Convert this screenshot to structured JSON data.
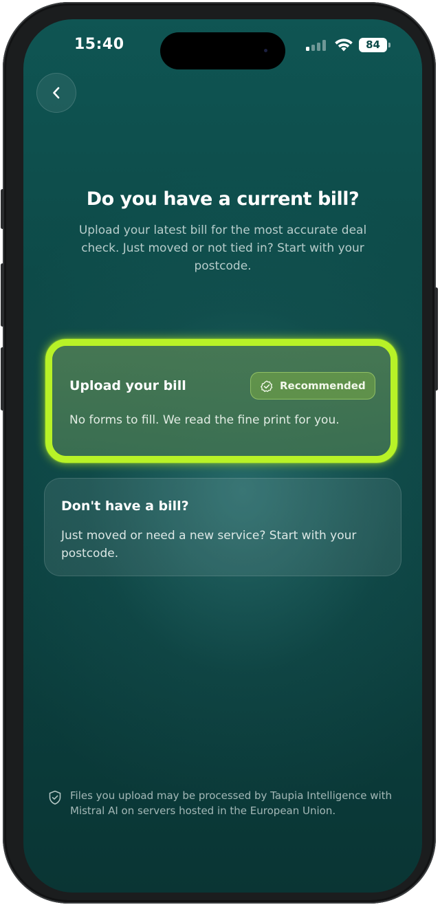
{
  "status_bar": {
    "time": "15:40",
    "battery": "84"
  },
  "header": {
    "title": "Do you have a current bill?",
    "subtitle": "Upload your latest bill for the most accurate deal check. Just moved or not tied in? Start with your postcode."
  },
  "options": {
    "upload": {
      "title": "Upload your bill",
      "badge": "Recommended",
      "description": "No forms to fill. We read the fine print for you."
    },
    "no_bill": {
      "title": "Don't have a bill?",
      "description": "Just moved or need a new service? Start with your postcode."
    }
  },
  "footer": {
    "notice": "Files you upload may be processed by Taupia Intelligence with Mistral AI on servers hosted in the European Union."
  },
  "icons": {
    "back": "chevron-left-icon",
    "badge": "check-badge-icon",
    "footer": "shield-check-icon"
  },
  "colors": {
    "accent": "#b8f227",
    "background": "#0d4a48",
    "text": "#ffffff"
  }
}
